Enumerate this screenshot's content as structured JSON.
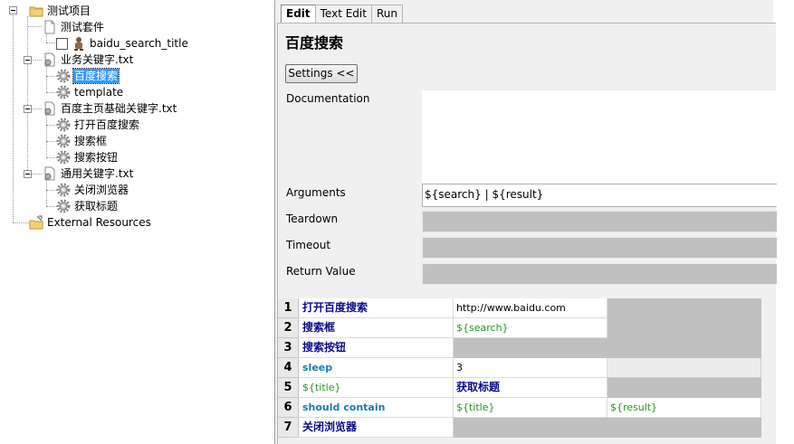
{
  "tree": {
    "root": "测试项目",
    "suite": "测试套件",
    "test_case": "baidu_search_title",
    "resource1": {
      "name": "业务关键字.txt",
      "items": [
        "百度搜索",
        "template"
      ]
    },
    "resource2": {
      "name": "百度主页基础关键字.txt",
      "items": [
        "打开百度搜索",
        "搜索框",
        "搜索按钮"
      ]
    },
    "resource3": {
      "name": "通用关键字.txt",
      "items": [
        "关闭浏览器",
        "获取标题"
      ]
    },
    "external": "External Resources"
  },
  "tabs": [
    "Edit",
    "Text Edit",
    "Run"
  ],
  "editor": {
    "keyword_name": "百度搜索",
    "settings_button": "Settings <<",
    "labels": {
      "documentation": "Documentation",
      "arguments": "Arguments",
      "teardown": "Teardown",
      "timeout": "Timeout",
      "return_value": "Return Value"
    },
    "arguments_value": "${search} | ${result}"
  },
  "steps": [
    {
      "num": "1",
      "c1": "打开百度搜索",
      "c2": "http://www.baidu.com",
      "c3": ""
    },
    {
      "num": "2",
      "c1": "搜索框",
      "c2": "${search}",
      "c3": ""
    },
    {
      "num": "3",
      "c1": "搜索按钮",
      "c2": "",
      "c3": ""
    },
    {
      "num": "4",
      "c1": "sleep",
      "c2": "3",
      "c3": ""
    },
    {
      "num": "5",
      "c1": "${title}",
      "c2": "获取标题",
      "c3": ""
    },
    {
      "num": "6",
      "c1": "should contain",
      "c2": "${title}",
      "c3": "${result}"
    },
    {
      "num": "7",
      "c1": "关闭浏览器",
      "c2": "",
      "c3": ""
    }
  ],
  "colors": {
    "selection": "#3399ff",
    "user_keyword": "#0a0a8c",
    "builtin_keyword": "#1a7ab8",
    "variable": "#229922",
    "disabled_cell": "#c0c0c0"
  }
}
